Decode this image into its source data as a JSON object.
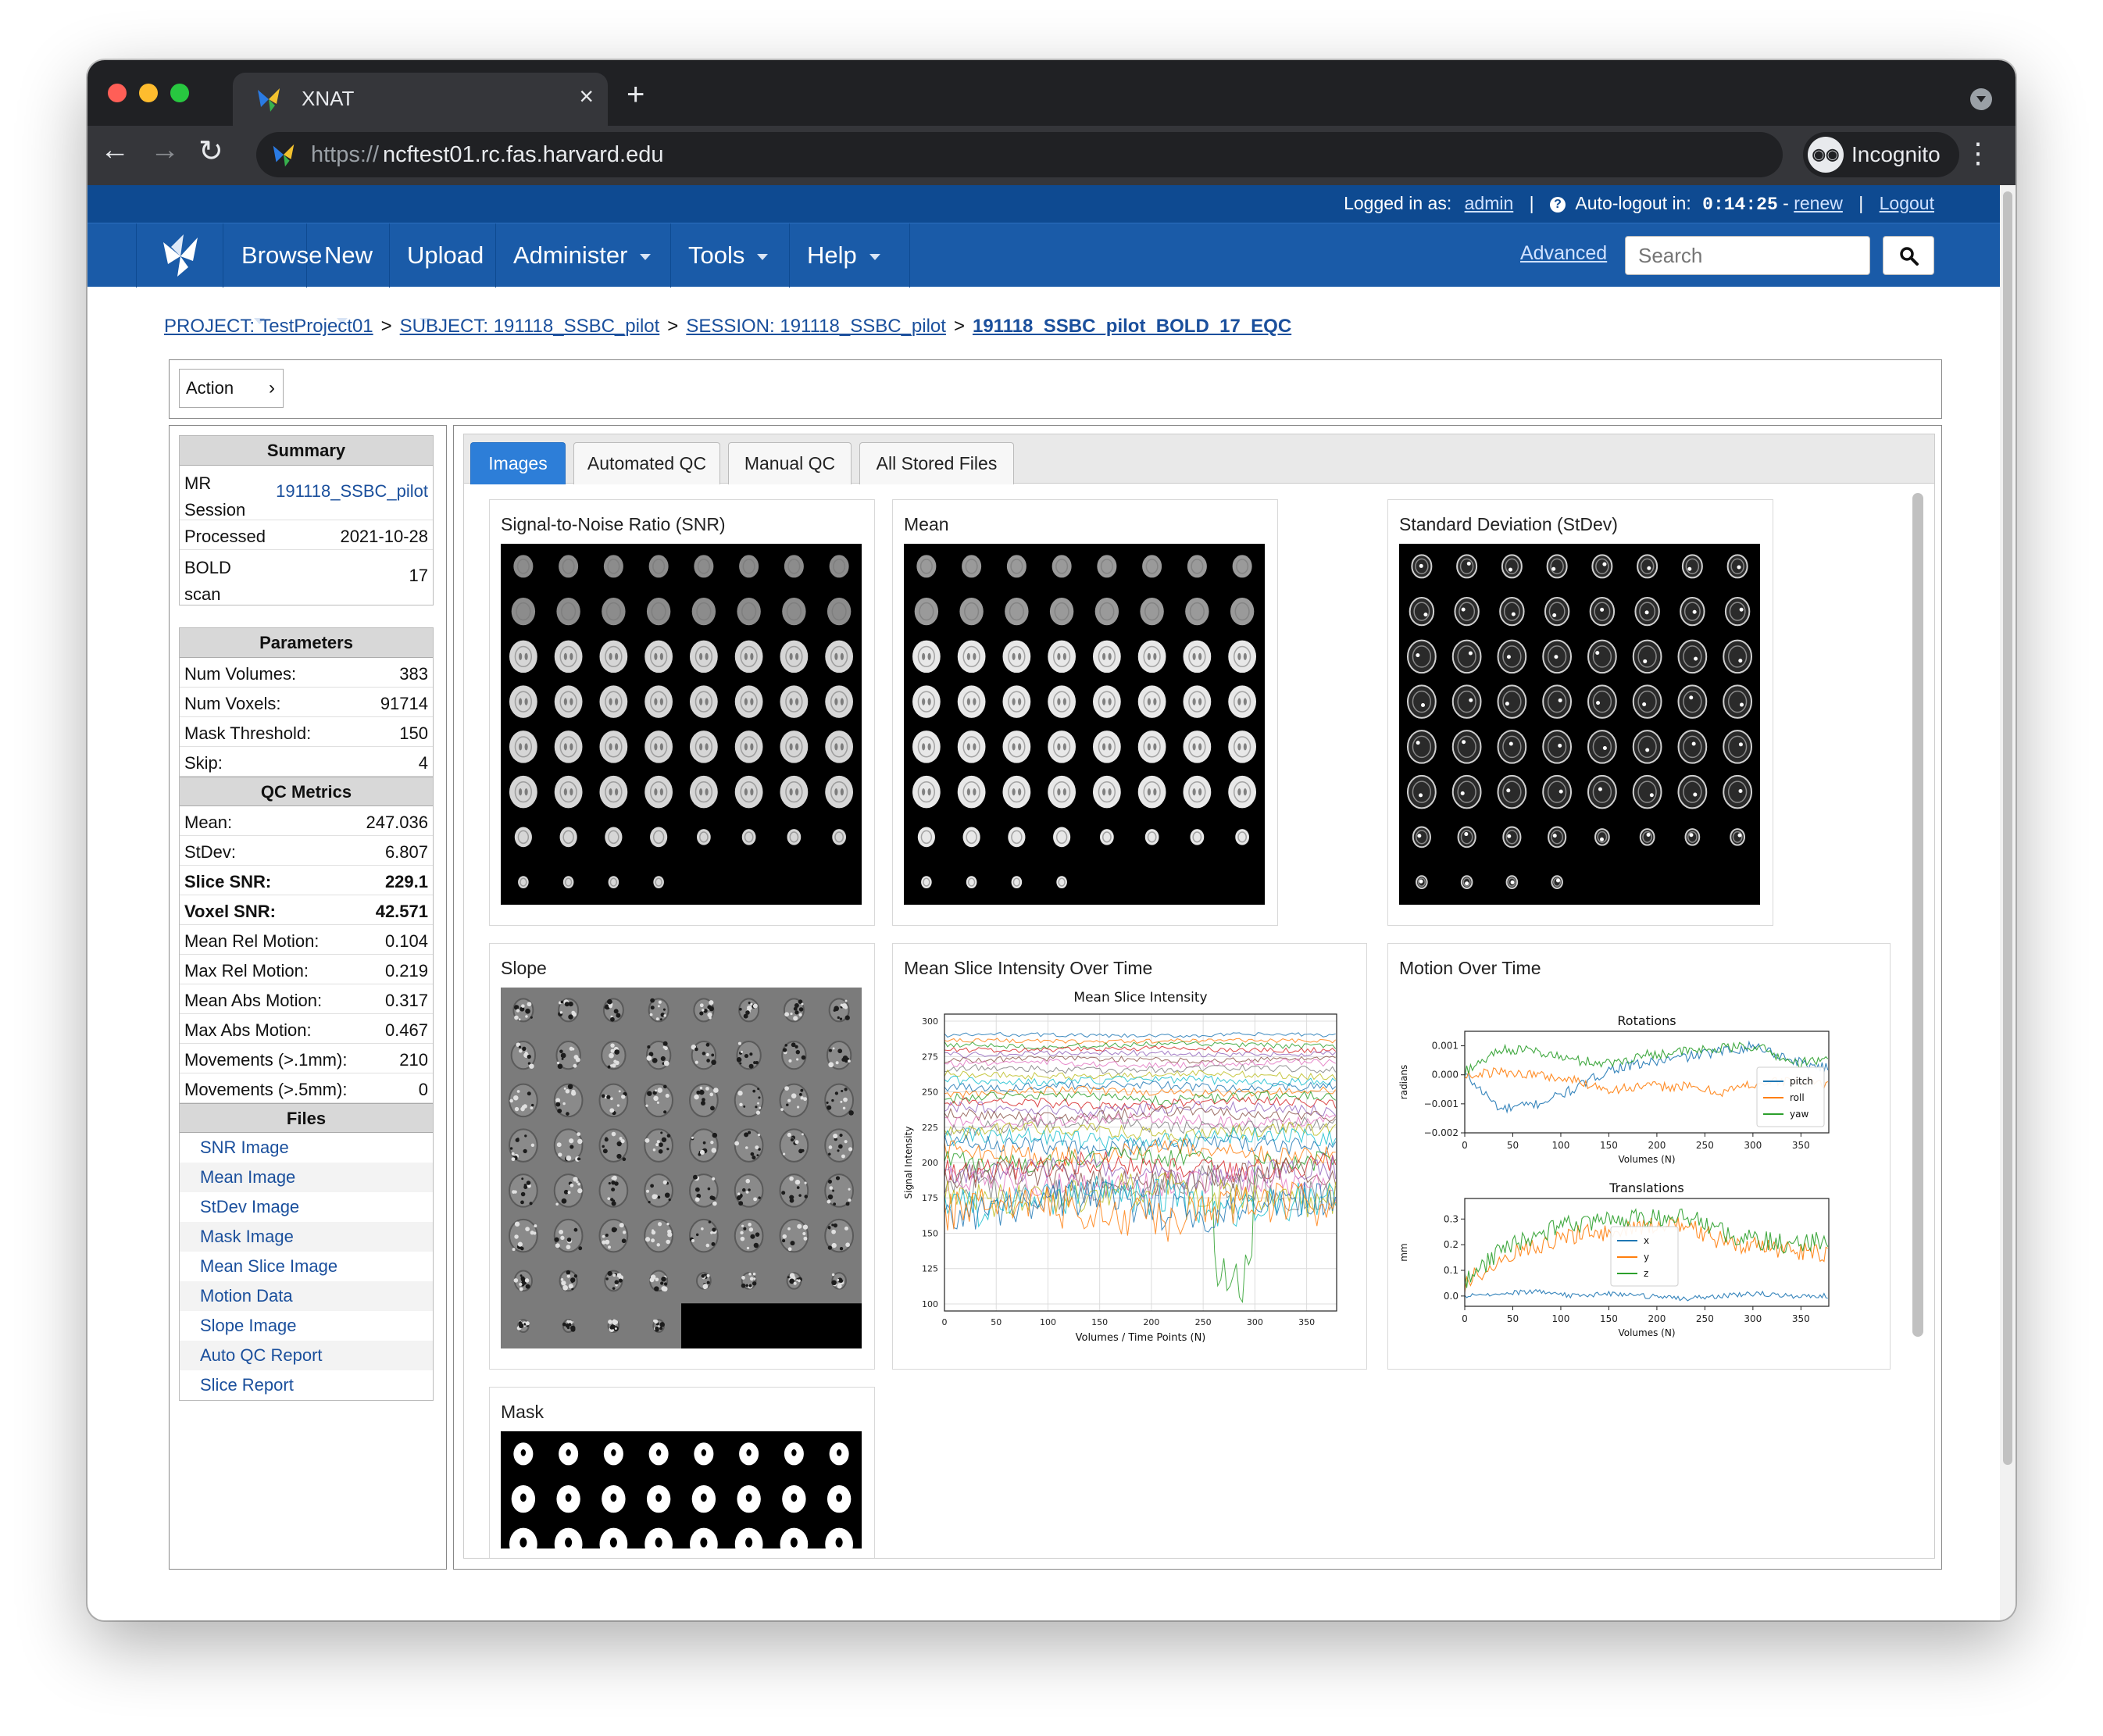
{
  "browser": {
    "tab_title": "XNAT",
    "url_scheme": "https://",
    "url_host": "ncftest01.rc.fas.harvard.edu",
    "incognito_label": "Incognito"
  },
  "header": {
    "logged_in_label": "Logged in as:",
    "username": "admin",
    "autologout_label": "Auto-logout in:",
    "autologout_time": "0:14:25",
    "renew_label": "renew",
    "logout_label": "Logout"
  },
  "nav": {
    "menu": [
      "Browse",
      "New",
      "Upload",
      "Administer",
      "Tools",
      "Help"
    ],
    "advanced_label": "Advanced",
    "search_placeholder": "Search"
  },
  "breadcrumb": {
    "project": "PROJECT: TestProject01",
    "subject": "SUBJECT: 191118_SSBC_pilot",
    "session": "SESSION: 191118_SSBC_pilot",
    "current": "191118_SSBC_pilot_BOLD_17_EQC",
    "separator": ">"
  },
  "action_label": "Action",
  "summary": {
    "heading": "Summary",
    "mr_session_label": "MR Session",
    "mr_session_value": "191118_SSBC_pilot",
    "processed_label": "Processed",
    "processed_value": "2021-10-28",
    "bold_scan_label": "BOLD scan",
    "bold_scan_value": "17"
  },
  "parameters": {
    "heading": "Parameters",
    "rows": [
      {
        "label": "Num Volumes:",
        "value": "383"
      },
      {
        "label": "Num Voxels:",
        "value": "91714"
      },
      {
        "label": "Mask Threshold:",
        "value": "150"
      },
      {
        "label": "Skip:",
        "value": "4"
      }
    ]
  },
  "qc_metrics": {
    "heading": "QC Metrics",
    "rows": [
      {
        "label": "Mean:",
        "value": "247.036"
      },
      {
        "label": "StDev:",
        "value": "6.807"
      },
      {
        "label": "Slice SNR:",
        "value": "229.1"
      },
      {
        "label": "Voxel SNR:",
        "value": "42.571"
      },
      {
        "label": "Mean Rel Motion:",
        "value": "0.104"
      },
      {
        "label": "Max Rel Motion:",
        "value": "0.219"
      },
      {
        "label": "Mean Abs Motion:",
        "value": "0.317"
      },
      {
        "label": "Max Abs Motion:",
        "value": "0.467"
      },
      {
        "label": "Movements (>.1mm):",
        "value": "210"
      },
      {
        "label": "Movements (>.5mm):",
        "value": "0"
      }
    ]
  },
  "files": {
    "heading": "Files",
    "items": [
      "SNR Image",
      "Mean Image",
      "StDev Image",
      "Mask Image",
      "Mean Slice Image",
      "Motion Data",
      "Slope Image",
      "Auto QC Report",
      "Slice Report"
    ]
  },
  "tabs": [
    "Images",
    "Automated QC",
    "Manual QC",
    "All Stored Files"
  ],
  "cards": {
    "snr": "Signal-to-Noise Ratio (SNR)",
    "mean": "Mean",
    "stdev": "Standard Deviation (StDev)",
    "slope": "Slope",
    "mean_slice": "Mean Slice Intensity Over Time",
    "motion": "Motion Over Time",
    "mask": "Mask"
  },
  "chart_data": [
    {
      "type": "line",
      "title": "Mean Slice Intensity",
      "xlabel": "Volumes / Time Points (N)",
      "ylabel": "Signal Intensity",
      "xlim": [
        0,
        379
      ],
      "ylim": [
        95,
        305
      ],
      "xticks": [
        "0",
        "50",
        "100",
        "150",
        "200",
        "250",
        "300",
        "350"
      ],
      "yticks": [
        "100",
        "125",
        "150",
        "175",
        "200",
        "225",
        "250",
        "275",
        "300"
      ],
      "grid": true,
      "series_levels": [
        290,
        286,
        283,
        280,
        277,
        273,
        270,
        266,
        262,
        258,
        254,
        250,
        246,
        242,
        238,
        234,
        230,
        226,
        222,
        217,
        212,
        207,
        202,
        197,
        193,
        189,
        185,
        181,
        177,
        173,
        169,
        165
      ],
      "series_noise": [
        1.5,
        1.5,
        2,
        2,
        2,
        2,
        2.5,
        2.5,
        2.5,
        3,
        3,
        3,
        3.5,
        3.5,
        4,
        4,
        4,
        5,
        5,
        6,
        6,
        7,
        7,
        8,
        9,
        10,
        10,
        12,
        12,
        14,
        14,
        16
      ]
    },
    {
      "type": "line",
      "title": "Rotations",
      "xlabel": "Volumes (N)",
      "ylabel": "radians",
      "xlim": [
        0,
        379
      ],
      "ylim": [
        -0.002,
        0.0015
      ],
      "xticks": [
        "0",
        "50",
        "100",
        "150",
        "200",
        "250",
        "300",
        "350"
      ],
      "yticks": [
        "0.001",
        "0.000",
        "−0.001",
        "−0.002"
      ],
      "legend": "bottom-right",
      "series": [
        {
          "name": "pitch",
          "color": "#1f77b4",
          "values": [
            0.0,
            -0.0012,
            -0.001,
            -0.0005,
            0.0002,
            0.0004,
            0.0006,
            0.0008,
            0.001,
            0.0005,
            0.0002
          ]
        },
        {
          "name": "roll",
          "color": "#ff7f0e",
          "values": [
            0.0,
            0.0001,
            0.0,
            -0.0002,
            -0.0005,
            -0.0004,
            -0.0004,
            -0.0006,
            -0.0003,
            -0.0002,
            -0.0003
          ]
        },
        {
          "name": "yaw",
          "color": "#2ca02c",
          "values": [
            0.0001,
            0.0009,
            0.0008,
            0.0005,
            0.0004,
            0.0007,
            0.0008,
            0.0009,
            0.001,
            0.0004,
            0.0005
          ]
        }
      ]
    },
    {
      "type": "line",
      "title": "Translations",
      "xlabel": "Volumes (N)",
      "ylabel": "mm",
      "xlim": [
        0,
        379
      ],
      "ylim": [
        -0.04,
        0.38
      ],
      "xticks": [
        "0",
        "50",
        "100",
        "150",
        "200",
        "250",
        "300",
        "350"
      ],
      "yticks": [
        "0.3",
        "0.2",
        "0.1",
        "0.0"
      ],
      "legend": "center",
      "series": [
        {
          "name": "x",
          "color": "#1f77b4",
          "values": [
            0.0,
            0.01,
            0.02,
            0.0,
            0.01,
            0.0,
            -0.01,
            0.0,
            0.01,
            0.0,
            0.0
          ]
        },
        {
          "name": "y",
          "color": "#ff7f0e",
          "values": [
            0.05,
            0.14,
            0.2,
            0.24,
            0.25,
            0.27,
            0.28,
            0.22,
            0.19,
            0.18,
            0.17
          ]
        },
        {
          "name": "z",
          "color": "#2ca02c",
          "values": [
            0.05,
            0.18,
            0.24,
            0.28,
            0.3,
            0.3,
            0.32,
            0.25,
            0.22,
            0.2,
            0.22
          ]
        }
      ]
    }
  ]
}
